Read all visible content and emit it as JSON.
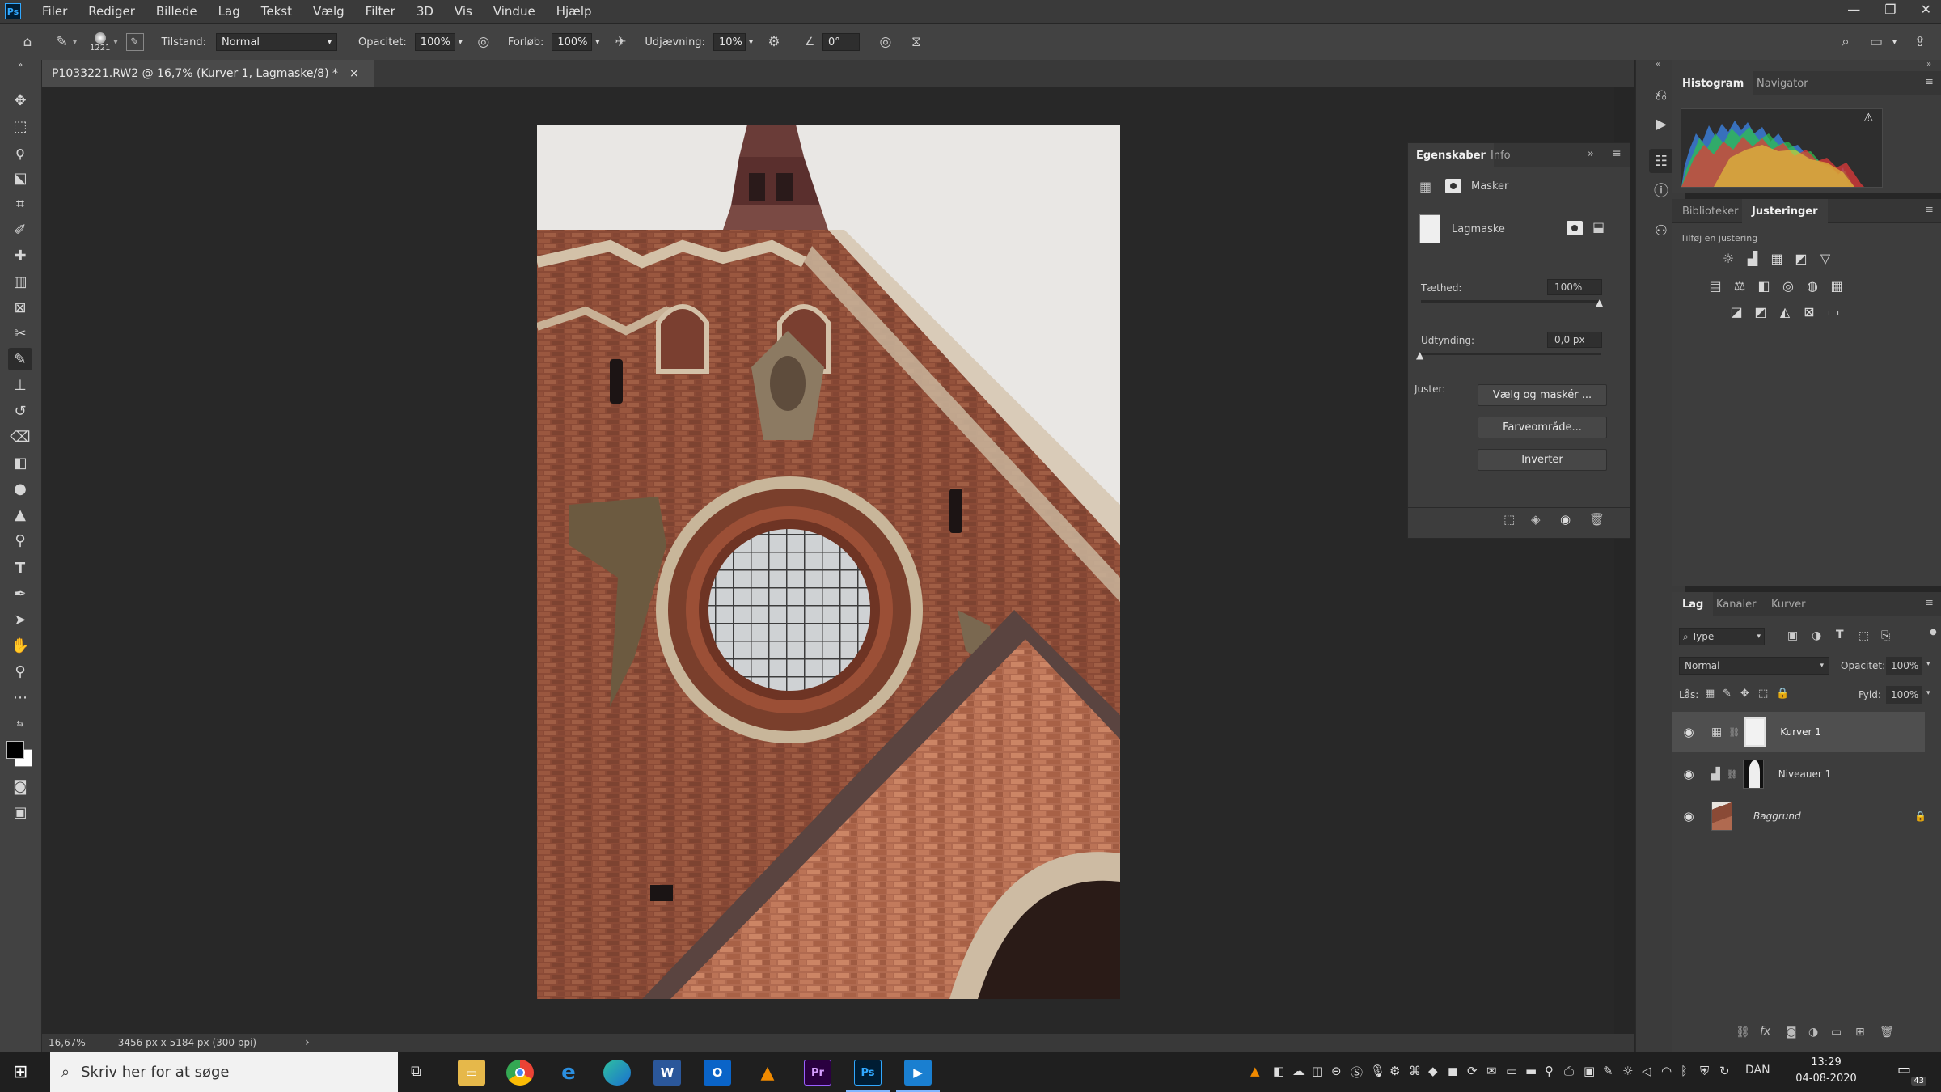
{
  "app": {
    "logo": "Ps"
  },
  "menu": [
    "Filer",
    "Rediger",
    "Billede",
    "Lag",
    "Tekst",
    "Vælg",
    "Filter",
    "3D",
    "Vis",
    "Vindue",
    "Hjælp"
  ],
  "window_controls": [
    "—",
    "❐",
    "✕"
  ],
  "options_bar": {
    "brush_size": "1221",
    "mode_label": "Tilstand:",
    "mode_value": "Normal",
    "opacity_label": "Opacitet:",
    "opacity_value": "100%",
    "flow_label": "Forløb:",
    "flow_value": "100%",
    "smoothing_label": "Udjævning:",
    "smoothing_value": "10%",
    "angle_value": "0°"
  },
  "document": {
    "tab_title": "P1033221.RW2 @ 16,7% (Kurver 1, Lagmaske/8) *",
    "tab_close": "×",
    "zoom": "16,67%",
    "doc_info": "3456 px x 5184 px (300 ppi)",
    "status_arrow": "›"
  },
  "properties": {
    "tabs": [
      "Egenskaber",
      "Info"
    ],
    "section_title": "Masker",
    "mask_type": "Lagmaske",
    "density_label": "Tæthed:",
    "density_value": "100%",
    "density_level": 1.0,
    "feather_label": "Udtynding:",
    "feather_value": "0,0 px",
    "feather_level": 0.0,
    "refine_label": "Juster:",
    "buttons": [
      "Vælg og maskér ...",
      "Farveområde...",
      "Inverter"
    ]
  },
  "histogram_panel": {
    "tabs": [
      "Histogram",
      "Navigator"
    ],
    "warning": "⚠"
  },
  "adjustments_panel": {
    "tabs": [
      "Biblioteker",
      "Justeringer"
    ],
    "hint": "Tilføj en justering",
    "icons": [
      "brightness-icon",
      "levels-icon",
      "curves-icon",
      "exposure-icon",
      "vibrance-icon",
      "hue-saturation-icon",
      "color-balance-icon",
      "black-white-icon",
      "photo-filter-icon",
      "channel-mixer-icon",
      "color-lookup-icon",
      "invert-icon",
      "posterize-icon",
      "threshold-icon",
      "selective-color-icon",
      "gradient-map-icon"
    ]
  },
  "layers_panel": {
    "tabs": [
      "Lag",
      "Kanaler",
      "Kurver"
    ],
    "filter_label": "Type",
    "blend_mode": "Normal",
    "opacity_label": "Opacitet:",
    "opacity_value": "100%",
    "lock_label": "Lås:",
    "fill_label": "Fyld:",
    "fill_value": "100%",
    "layers": [
      {
        "name": "Kurver 1",
        "selected": true
      },
      {
        "name": "Niveauer 1",
        "selected": false
      },
      {
        "name": "Baggrund",
        "selected": false
      }
    ]
  },
  "taskbar": {
    "search_placeholder": "Skriv her for at søge",
    "apps": [
      "File Explorer",
      "Chrome",
      "Edge (legacy)",
      "Edge",
      "W",
      "O",
      "VLC",
      "Pr",
      "Ps",
      "Media"
    ],
    "language": "DAN",
    "time": "13:29",
    "date": "04-08-2020",
    "notifications": "43"
  },
  "colors": {
    "accent": "#31a8ff",
    "panel": "#3d3d3d",
    "canvas_bg": "#282828"
  }
}
